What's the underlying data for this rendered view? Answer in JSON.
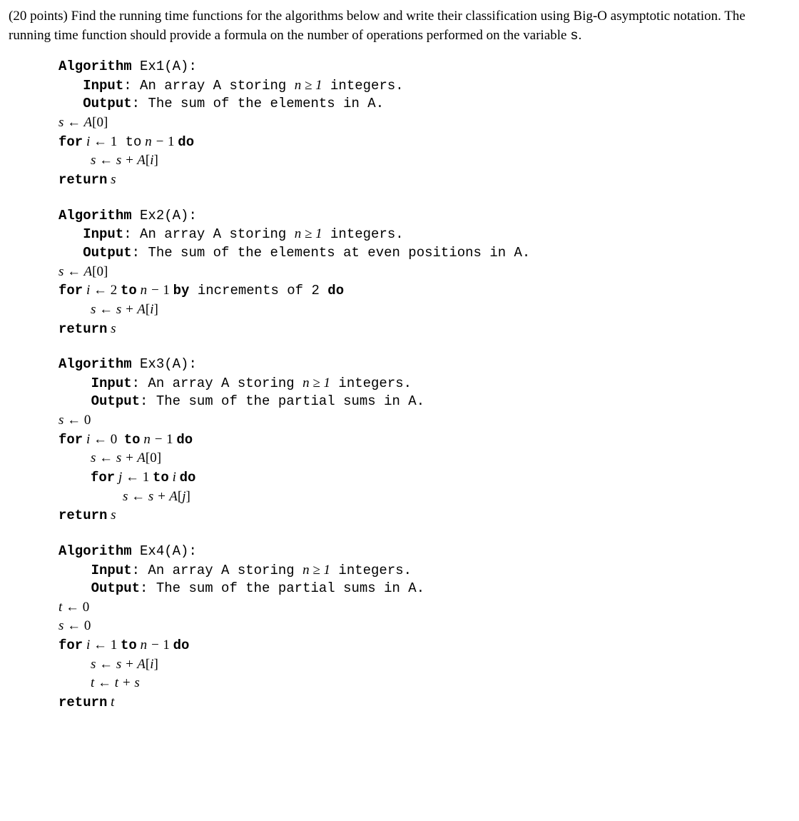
{
  "preamble": {
    "points": "(20 points)",
    "text1": " Find the running time functions for the algorithms below and write their classification using Big-O asymptotic notation. The running time function should provide a formula on the number of operations performed on the variable ",
    "varS": " s",
    "period": "."
  },
  "kw": {
    "algorithm": "Algorithm",
    "input": "Input",
    "output": "Output",
    "for": "for",
    "to": "to",
    "by": "by",
    "do": "do",
    "return": "return"
  },
  "ex1": {
    "title": " Ex1(A):",
    "input": ": An array A storing ",
    "inputCond": "n ≥ 1",
    "inputEnd": " integers.",
    "output": ": The sum of the elements in A.",
    "l1a": "s ← A",
    "l1b": "[0]",
    "l2a": " i ← ",
    "l2b": "1",
    "l2c": " n − ",
    "l2d": "1 ",
    "l3a": "s ← s + A",
    "l3b": "[i]",
    "l4": " s"
  },
  "ex2": {
    "title": " Ex2(A):",
    "input": ": An array A storing ",
    "inputCond": "n ≥ 1",
    "inputEnd": " integers.",
    "output": ": The sum of the elements at even positions in A.",
    "l1a": "s ← A",
    "l1b": "[0]",
    "l2a": " i ← ",
    "l2b": "2 ",
    "l2c": " n − ",
    "l2d": "1 ",
    "l2e": " increments of 2 ",
    "l3a": "s ← s + A",
    "l3b": "[i]",
    "l4": " s"
  },
  "ex3": {
    "title": " Ex3(A):",
    "input": ": An array A storing ",
    "inputCond": "n ≥ 1",
    "inputEnd": " integers.",
    "output": ": The sum of the partial sums in A.",
    "l1": "s ← ",
    "l1b": "0",
    "l2a": " i ← ",
    "l2b": "0  ",
    "l2c": " n − ",
    "l2d": "1 ",
    "l3a": "s ← s + A",
    "l3b": "[0]",
    "l4a": " j ← ",
    "l4b": "1 ",
    "l4c": " i ",
    "l5a": "s ← s + A",
    "l5b": "[j]",
    "l6": " s"
  },
  "ex4": {
    "title": " Ex4(A):",
    "input": ": An array A storing ",
    "inputCond": "n ≥ 1",
    "inputEnd": " integers.",
    "output": ": The sum of the partial sums in A.",
    "l1": "t ← ",
    "l1b": "0",
    "l2": "s ← ",
    "l2b": "0",
    "l3a": " i ← ",
    "l3b": "1 ",
    "l3c": " n − ",
    "l3d": "1 ",
    "l4a": "s ← s + A",
    "l4b": "[i]",
    "l5": "t ← t + s",
    "l6": " t"
  }
}
